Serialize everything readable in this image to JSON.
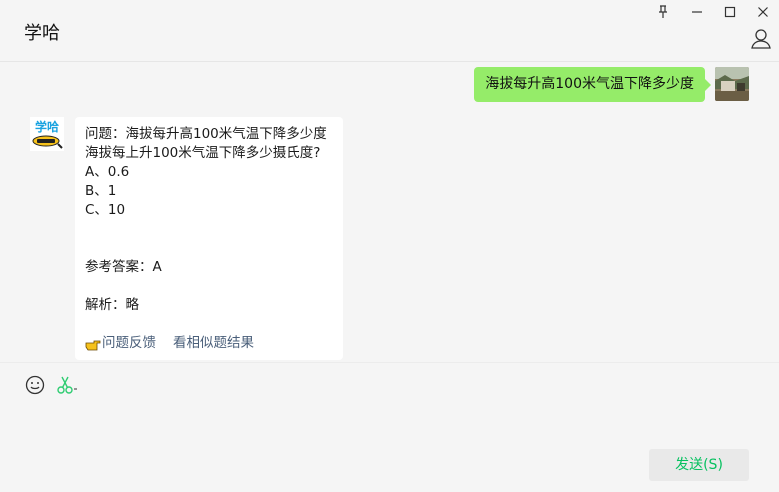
{
  "window": {
    "title": "学哈",
    "controls": {
      "pin": "⊥",
      "minimize": "—",
      "maximize": "☐",
      "close": "✕"
    },
    "icons": [
      "pin-icon",
      "minimize-icon",
      "maximize-icon",
      "close-icon",
      "person-icon"
    ]
  },
  "messages": {
    "user_query": "海拔每升高100米气温下降多少度",
    "bot": {
      "logo_text": "学哈",
      "question_label": "问题：海拔每升高100米气温下降多少度",
      "question_text": "海拔每上升100米气温下降多少摄氏度?",
      "options": [
        "A、0.6",
        "B、1",
        "C、10"
      ],
      "answer": "参考答案：A",
      "analysis": "解析：略",
      "feedback_link": "问题反馈",
      "similar_link": "看相似题结果"
    }
  },
  "input": {
    "send_label": "发送(S)",
    "icons": [
      "emoji-icon",
      "scissors-icon"
    ]
  },
  "colors": {
    "user_bubble": "#95ec69",
    "send_text": "#07c160",
    "scissors": "#2ecc71",
    "link": "#4a5f7a"
  }
}
